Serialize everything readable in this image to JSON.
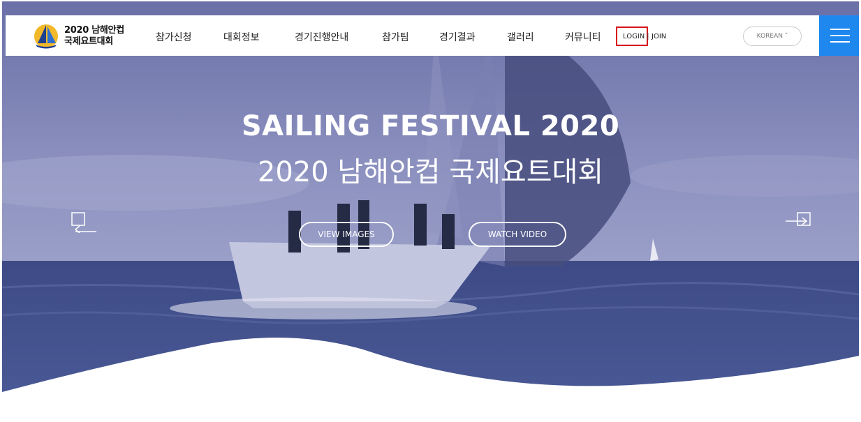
{
  "brand": {
    "line1": "2020 남해안컵",
    "line2": "국제요트대회"
  },
  "nav": [
    "참가신청",
    "대회정보",
    "경기진행안내",
    "참가팀",
    "경기결과",
    "갤러리",
    "커뮤니티"
  ],
  "auth": {
    "login": "LOGIN",
    "separator": "|",
    "join": "JOIN"
  },
  "language": {
    "label": "KOREAN ˅"
  },
  "hero": {
    "title_en": "SAILING FESTIVAL 2020",
    "title_ko": "2020 남해안컵 국제요트대회",
    "btn_images": "VIEW IMAGES",
    "btn_video": "WATCH VIDEO"
  },
  "colors": {
    "accent": "#1e88ef",
    "highlight": "#d9121b",
    "overlay": "#5b6598"
  },
  "icons": {
    "prev": "arrow-left-icon",
    "next": "arrow-right-icon",
    "menu": "hamburger-icon",
    "logo": "sailboat-logo-icon"
  }
}
